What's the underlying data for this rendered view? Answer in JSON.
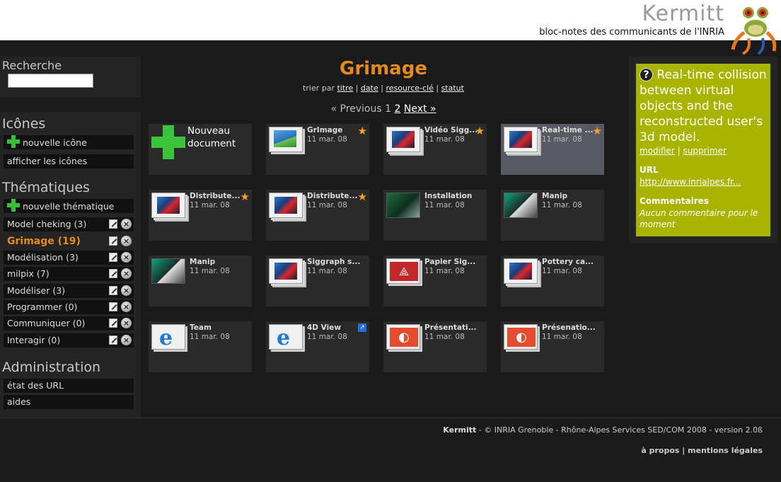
{
  "header": {
    "title": "Kermitt",
    "subtitle": "bloc-notes des communicants de l'INRIA"
  },
  "sidebar": {
    "search_heading": "Recherche",
    "search_value": "",
    "icons_heading": "Icônes",
    "icons_items": [
      {
        "label": "nouvelle icône"
      },
      {
        "label": "afficher les icônes"
      }
    ],
    "themes_heading": "Thématiques",
    "new_theme_label": "nouvelle thématique",
    "themes": [
      {
        "label": "Model cheking (3)",
        "active": false
      },
      {
        "label": "Grimage (19)",
        "active": true
      },
      {
        "label": "Modélisation (3)",
        "active": false
      },
      {
        "label": "milpix (7)",
        "active": false
      },
      {
        "label": "Modéliser (3)",
        "active": false
      },
      {
        "label": "Programmer (0)",
        "active": false
      },
      {
        "label": "Communiquer (0)",
        "active": false
      },
      {
        "label": "Interagir (0)",
        "active": false
      }
    ],
    "admin_heading": "Administration",
    "admin_items": [
      {
        "label": "état des URL"
      },
      {
        "label": "aides"
      }
    ]
  },
  "main": {
    "title": "Grimage",
    "sort_prefix": "trier par",
    "sort_links": [
      "titre",
      "date",
      "resource-clé",
      "statut"
    ],
    "pager": {
      "previous": "« Previous",
      "page1": "1",
      "page2": "2",
      "next": "Next »"
    },
    "new_doc_label": "Nouveau document",
    "cards": [
      {
        "title": "GrImage",
        "date": "11 mar. 08",
        "thumb": "img",
        "badge": "star",
        "selected": false
      },
      {
        "title": "Vidéo Sigg...",
        "date": "11 mar. 08",
        "thumb": "stack",
        "badge": "star",
        "selected": false
      },
      {
        "title": "Real-time ...",
        "date": "11 mar. 08",
        "thumb": "stack",
        "badge": "star",
        "selected": true
      },
      {
        "title": "Distribute...",
        "date": "11 mar. 08",
        "thumb": "stack",
        "badge": "star",
        "selected": false
      },
      {
        "title": "Distribute...",
        "date": "11 mar. 08",
        "thumb": "stack",
        "badge": "star",
        "selected": false
      },
      {
        "title": "Installation",
        "date": "11 mar. 08",
        "thumb": "photo",
        "badge": "",
        "selected": false
      },
      {
        "title": "Manip",
        "date": "11 mar. 08",
        "thumb": "photo2",
        "badge": "",
        "selected": false
      },
      {
        "title": "Manip",
        "date": "11 mar. 08",
        "thumb": "photo2",
        "badge": "",
        "selected": false
      },
      {
        "title": "Siggraph s...",
        "date": "11 mar. 08",
        "thumb": "stack",
        "badge": "",
        "selected": false
      },
      {
        "title": "Papier Sig...",
        "date": "11 mar. 08",
        "thumb": "pdf",
        "badge": "",
        "selected": false
      },
      {
        "title": "Pottery ca...",
        "date": "11 mar. 08",
        "thumb": "stack",
        "badge": "",
        "selected": false
      },
      {
        "title": "Team",
        "date": "11 mar. 08",
        "thumb": "ie",
        "badge": "",
        "selected": false
      },
      {
        "title": "4D View",
        "date": "11 mar. 08",
        "thumb": "ie",
        "badge": "link",
        "selected": false
      },
      {
        "title": "Présentati...",
        "date": "11 mar. 08",
        "thumb": "ppt",
        "badge": "",
        "selected": false
      },
      {
        "title": "Présenatio...",
        "date": "11 mar. 08",
        "thumb": "ppt",
        "badge": "",
        "selected": false
      }
    ]
  },
  "detail": {
    "title": "Real-time collision between virtual objects and the reconstructed user's 3d model.",
    "modify": "modifier",
    "delete": "supprimer",
    "url_label": "URL",
    "url_value": "http://www.inrialpes.fr...",
    "comments_label": "Commentaires",
    "comments_value": "Aucun commentaire pour le moment"
  },
  "footer": {
    "brand": "Kermitt",
    "credit": " - © INRIA Grenoble - Rhône-Alpes Services SED/COM 2008 - version 2.0ß",
    "about": "à propos",
    "legal": "mentions légales"
  },
  "colors": {
    "accent": "#e58a1f",
    "detail_bg": "#a9b400",
    "star": "#f3a61f"
  }
}
